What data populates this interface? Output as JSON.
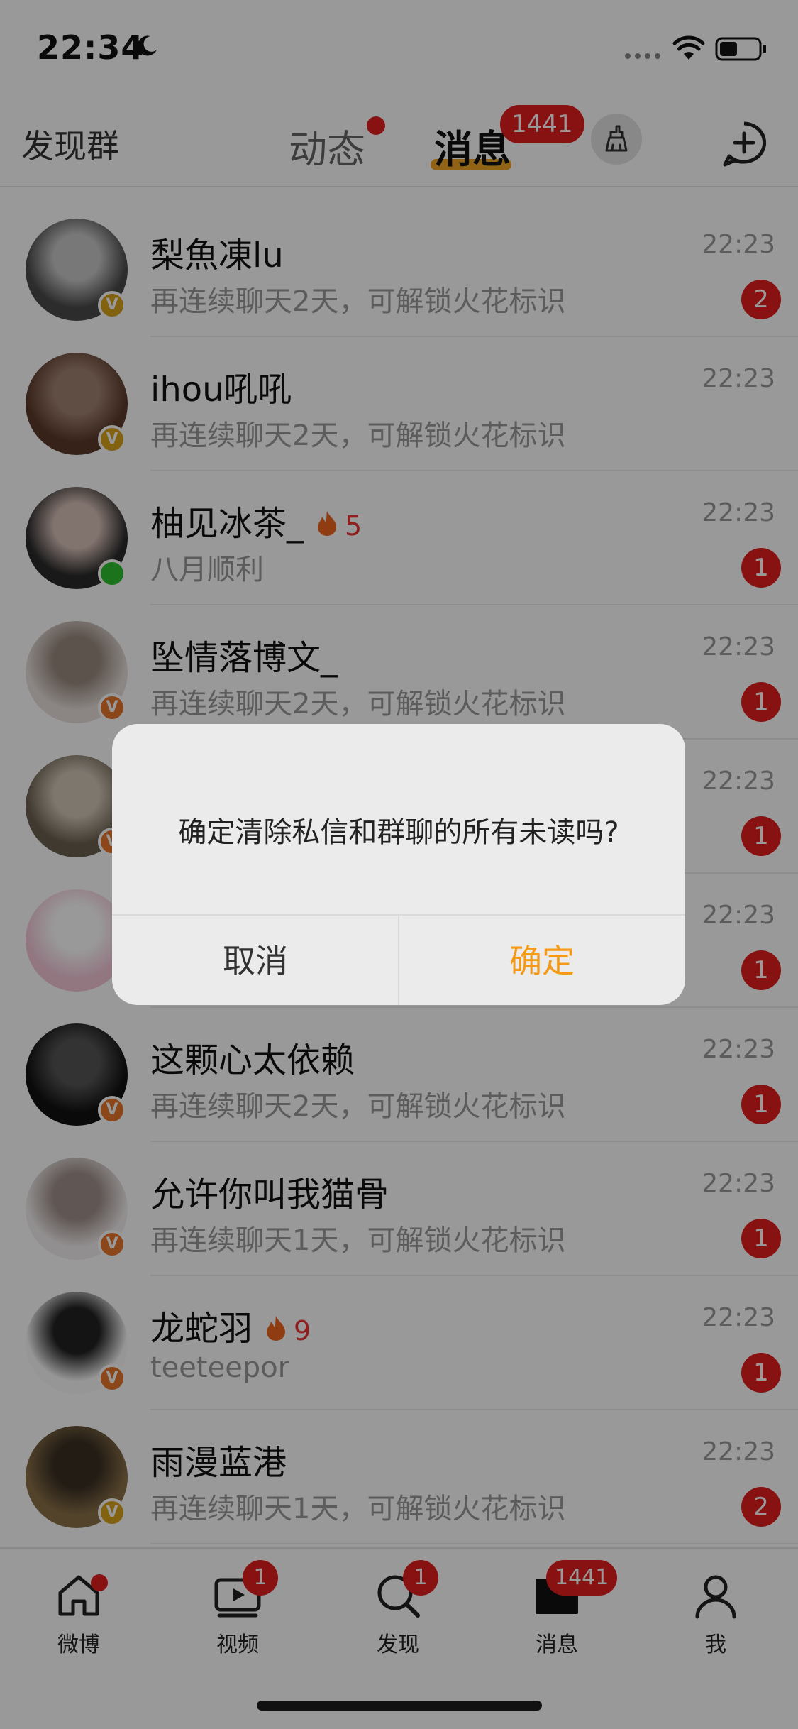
{
  "status_bar": {
    "time": "22:34"
  },
  "top_nav": {
    "discover_groups": "发现群",
    "tab_feed": "动态",
    "tab_messages": "消息",
    "messages_badge": "1441"
  },
  "messages": [
    {
      "name": "梨魚凍lu",
      "preview": "再连续聊天2天，可解锁火花标识",
      "time": "22:23",
      "unread": "2",
      "badge": "v",
      "badge_color": "#d9a21a",
      "avatar_colors": [
        "#4a4a4a",
        "#c9c9c9"
      ]
    },
    {
      "name": "ihou吼吼",
      "preview": "再连续聊天2天，可解锁火花标识",
      "time": "22:23",
      "unread": "",
      "badge": "v",
      "badge_color": "#d9a21a",
      "avatar_colors": [
        "#5b3a2a",
        "#a08070"
      ]
    },
    {
      "name": "柚见冰茶_",
      "fire_count": "5",
      "preview": "八月顺利",
      "time": "22:23",
      "unread": "1",
      "badge": "online",
      "avatar_colors": [
        "#2a2a2a",
        "#d8c0b8"
      ]
    },
    {
      "name": "坠情落博文_",
      "preview": "再连续聊天2天，可解锁火花标识",
      "time": "22:23",
      "unread": "1",
      "badge": "v",
      "badge_color": "#e8752a",
      "avatar_colors": [
        "#e8e0dc",
        "#9a8a80"
      ]
    },
    {
      "name": "",
      "preview": "",
      "time": "22:23",
      "unread": "1",
      "badge": "v",
      "badge_color": "#e8752a",
      "avatar_colors": [
        "#6b6050",
        "#d0c6b8"
      ]
    },
    {
      "name": "",
      "preview": "",
      "time": "22:23",
      "unread": "1",
      "badge": "",
      "avatar_colors": [
        "#f3c6d8",
        "#ffffff"
      ]
    },
    {
      "name": "这颗心太依赖",
      "preview": "再连续聊天2天，可解锁火花标识",
      "time": "22:23",
      "unread": "1",
      "badge": "v",
      "badge_color": "#e8752a",
      "avatar_colors": [
        "#111111",
        "#555555"
      ]
    },
    {
      "name": "允许你叫我猫骨",
      "preview": "再连续聊天1天，可解锁火花标识",
      "time": "22:23",
      "unread": "1",
      "badge": "v",
      "badge_color": "#e8752a",
      "avatar_colors": [
        "#f2eeee",
        "#a0908a"
      ]
    },
    {
      "name": "龙蛇羽",
      "fire_count": "9",
      "preview": "teeteepor",
      "time": "22:23",
      "unread": "1",
      "badge": "v",
      "badge_color": "#e8752a",
      "avatar_colors": [
        "#fafafa",
        "#222222"
      ]
    },
    {
      "name": "雨漫蓝港",
      "preview": "再连续聊天1天，可解锁火花标识",
      "time": "22:23",
      "unread": "2",
      "badge": "v",
      "badge_color": "#d9a21a",
      "avatar_colors": [
        "#8a7048",
        "#3a3024"
      ]
    }
  ],
  "dialog": {
    "message": "确定清除私信和群聊的所有未读吗?",
    "cancel": "取消",
    "confirm": "确定"
  },
  "tab_bar": {
    "home": "微博",
    "video": "视频",
    "video_badge": "1",
    "discover": "发现",
    "discover_badge": "1",
    "messages": "消息",
    "messages_badge": "1441",
    "me": "我"
  },
  "colors": {
    "accent_orange": "#f59a16",
    "badge_red": "#e31d1d",
    "tab_underline": "#f2a526"
  }
}
